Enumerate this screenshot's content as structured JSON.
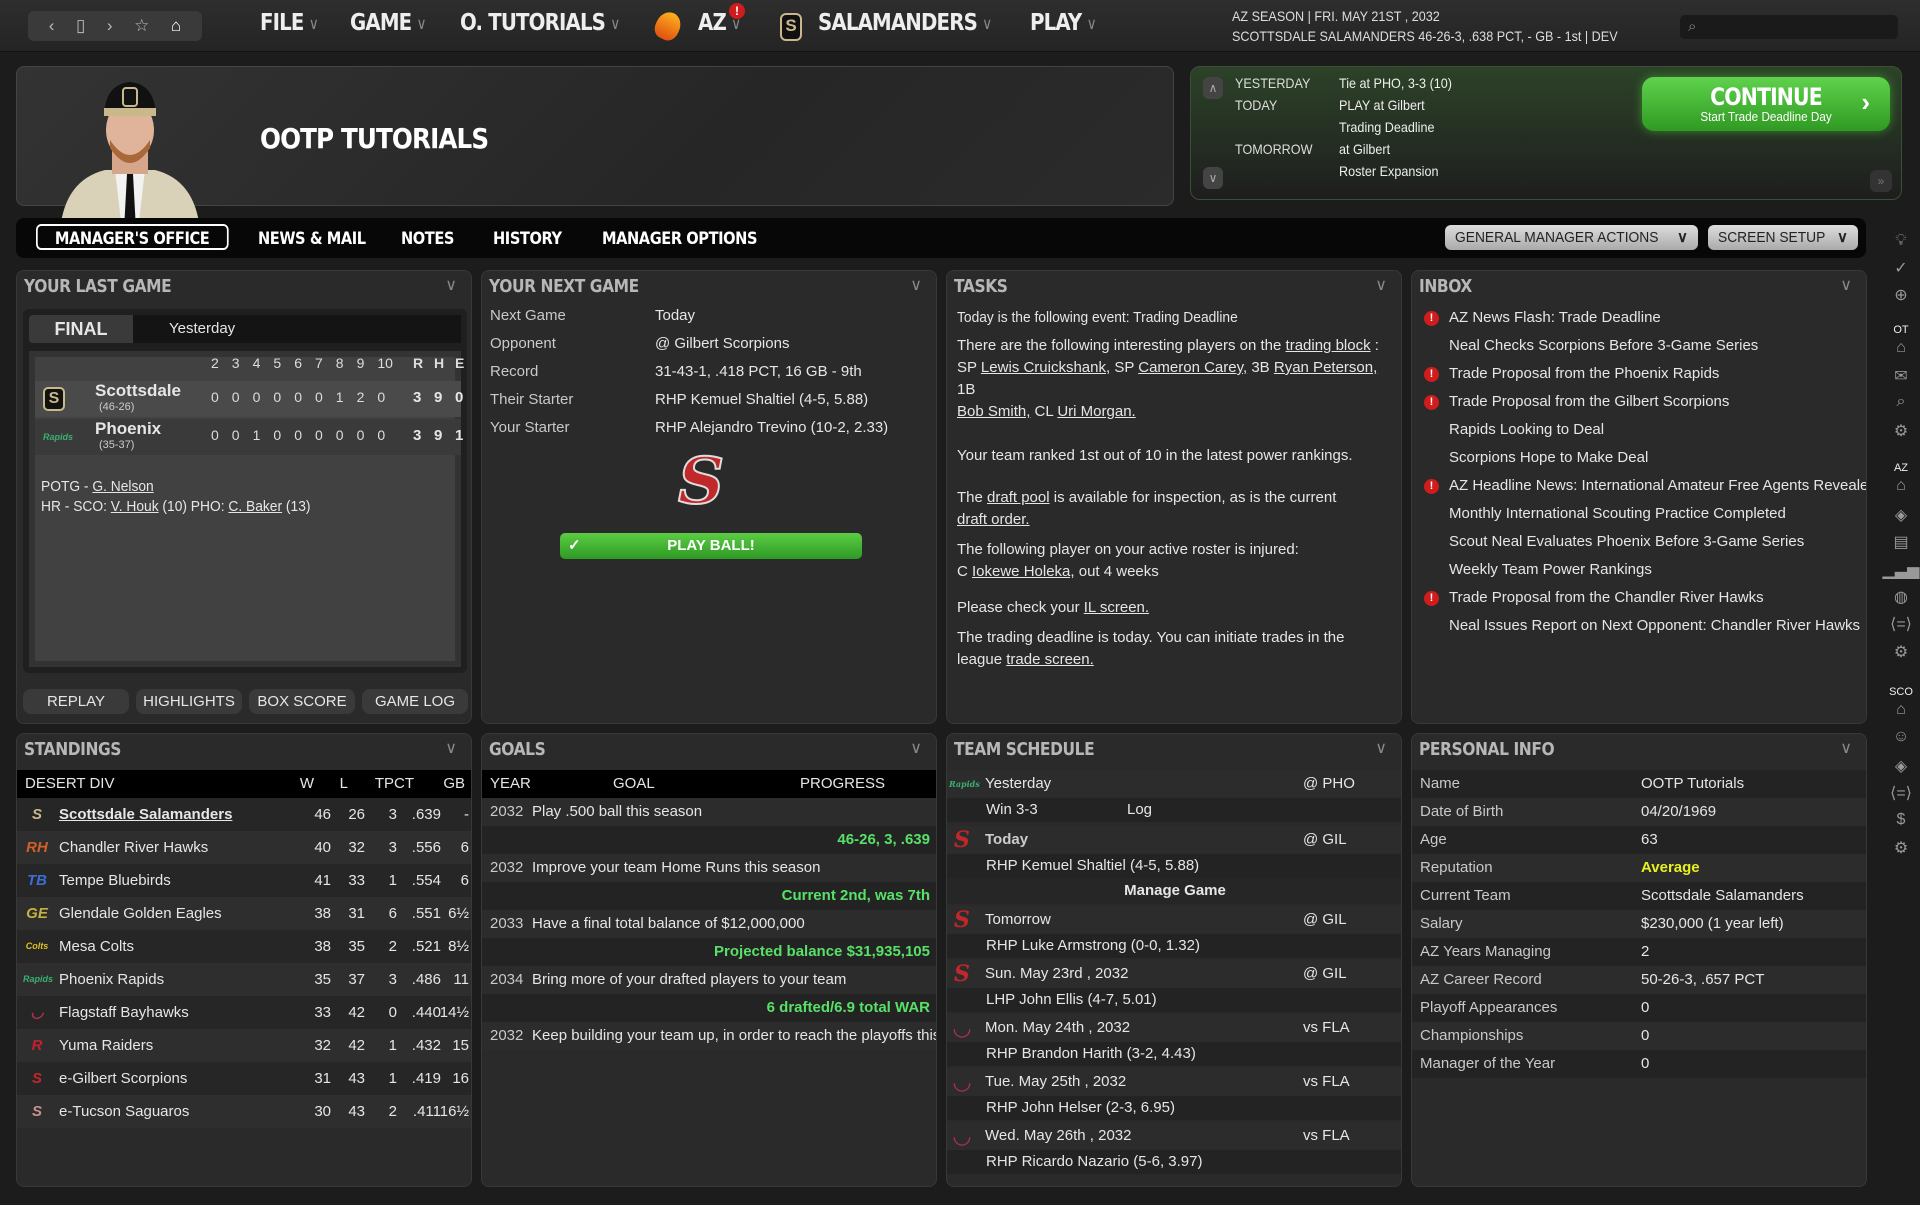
{
  "topbar": {
    "nav_icons": [
      "back-icon",
      "page-icon",
      "forward-icon",
      "star-icon",
      "home-icon"
    ],
    "menus": [
      {
        "label": "FILE"
      },
      {
        "label": "GAME"
      },
      {
        "label": "O. TUTORIALS"
      },
      {
        "label": "AZ",
        "alert": "!"
      },
      {
        "label": "SALAMANDERS"
      },
      {
        "label": "PLAY"
      }
    ],
    "season_line": "AZ SEASON  |  FRI. MAY 21ST , 2032",
    "team_line": "SCOTTSDALE SALAMANDERS   46-26-3, .638 PCT, - GB - 1st | DEV",
    "search_placeholder": ""
  },
  "header": {
    "title": "OOTP TUTORIALS"
  },
  "day_info": {
    "rows": [
      {
        "label": "YESTERDAY",
        "value": "Tie at PHO, 3-3 (10)"
      },
      {
        "label": "TODAY",
        "value": "PLAY at Gilbert"
      },
      {
        "label": "",
        "value": "Trading Deadline"
      },
      {
        "label": "TOMORROW",
        "value": "at Gilbert"
      },
      {
        "label": "",
        "value": "Roster Expansion"
      }
    ],
    "continue_label": "CONTINUE",
    "continue_sub": "Start Trade Deadline Day"
  },
  "tabs": [
    {
      "label": "MANAGER'S OFFICE",
      "active": true
    },
    {
      "label": "NEWS & MAIL"
    },
    {
      "label": "NOTES"
    },
    {
      "label": "HISTORY"
    },
    {
      "label": "MANAGER OPTIONS"
    }
  ],
  "actions": {
    "gm_actions": "GENERAL MANAGER ACTIONS",
    "screen_setup": "SCREEN SETUP"
  },
  "sidebar": {
    "groups": [
      {
        "label": "",
        "icons": [
          "lightbulb-icon",
          "checkmark-icon",
          "globe-icon"
        ]
      },
      {
        "label": "OT",
        "icons": [
          "home-icon",
          "mail-icon",
          "search-icon",
          "gear-icon"
        ]
      },
      {
        "label": "AZ",
        "icons": [
          "home-icon",
          "eye-icon",
          "id-card-icon",
          "bar-chart-icon",
          "baseball-icon",
          "trade-icon",
          "gear-icon"
        ]
      },
      {
        "label": "SCO",
        "icons": [
          "home-icon",
          "manager-icon",
          "eye-icon",
          "trade-icon",
          "dollar-icon",
          "gear-icon"
        ]
      }
    ]
  },
  "last_game": {
    "title": "YOUR LAST GAME",
    "status": "FINAL",
    "when": "Yesterday",
    "innings": [
      "2",
      "3",
      "4",
      "5",
      "6",
      "7",
      "8",
      "9",
      "10"
    ],
    "rhe": [
      "R",
      "H",
      "E"
    ],
    "teams": [
      {
        "name": "Scottsdale",
        "record": "(46-26)",
        "line": [
          "0",
          "0",
          "0",
          "0",
          "0",
          "0",
          "1",
          "2",
          "0"
        ],
        "r": "3",
        "h": "9",
        "e": "0"
      },
      {
        "name": "Phoenix",
        "record": "(35-37)",
        "line": [
          "0",
          "0",
          "1",
          "0",
          "0",
          "0",
          "0",
          "0",
          "0"
        ],
        "r": "3",
        "h": "9",
        "e": "1"
      }
    ],
    "potg_label": "POTG - ",
    "potg": "G. Nelson",
    "hr_label": "HR - SCO: ",
    "hr_sco": "V. Houk",
    "hr_sco_n": " (10)  PHO: ",
    "hr_pho": "C. Baker",
    "hr_pho_n": " (13)",
    "buttons": [
      "REPLAY",
      "HIGHLIGHTS",
      "BOX SCORE",
      "GAME LOG"
    ]
  },
  "next_game": {
    "title": "YOUR NEXT GAME",
    "rows": [
      {
        "label": "Next Game",
        "value": "Today"
      },
      {
        "label": "Opponent",
        "value": "@ Gilbert Scorpions"
      },
      {
        "label": "Record",
        "value": "31-43-1, .418 PCT, 16 GB - 9th"
      },
      {
        "label": "Their Starter",
        "value": "RHP Kemuel Shaltiel (4-5, 5.88)"
      },
      {
        "label": "Your Starter",
        "value": "RHP Alejandro Trevino (10-2, 2.33)"
      }
    ],
    "play_label": "PLAY BALL!"
  },
  "tasks": {
    "title": "TASKS",
    "event": "Today is the following event: Trading Deadline",
    "block_intro": "There are the following interesting players on the ",
    "block_link": "trading block",
    "players": [
      {
        "pos": "SP",
        "name": "Lewis Cruickshank,"
      },
      {
        "pos": "SP",
        "name": "Cameron Carey,"
      },
      {
        "pos": "3B",
        "name": "Ryan Peterson,"
      },
      {
        "pos": "1B",
        "name": "Bob Smith,"
      },
      {
        "pos": "CL",
        "name": "Uri Morgan."
      }
    ],
    "rank": "Your team ranked 1st out of 10 in the latest power rankings.",
    "draft_a": "The ",
    "draft_pool": "draft pool",
    "draft_b": " is available for inspection, as is the current",
    "draft_order": "draft order.",
    "injured": "The following player on your active roster is injured:",
    "inj_pos": "C ",
    "inj_name": "Iokewe Holeka,",
    "inj_out": " out 4 weeks",
    "il_a": "Please check your ",
    "il_link": "IL screen.",
    "trade_a": "The trading deadline is today. You can initiate trades in the",
    "trade_b": "league ",
    "trade_link": "trade screen."
  },
  "inbox": {
    "title": "INBOX",
    "items": [
      {
        "text": "AZ News Flash: Trade Deadline",
        "alert": true
      },
      {
        "text": "Neal Checks Scorpions Before 3-Game Series",
        "alert": false
      },
      {
        "text": "Trade Proposal from the Phoenix Rapids",
        "alert": true
      },
      {
        "text": "Trade Proposal from the Gilbert Scorpions",
        "alert": true
      },
      {
        "text": "Rapids Looking to Deal",
        "alert": false
      },
      {
        "text": "Scorpions Hope to Make Deal",
        "alert": false
      },
      {
        "text": "AZ Headline News: International Amateur Free Agents Reveale",
        "alert": true
      },
      {
        "text": "Monthly International Scouting Practice Completed",
        "alert": false
      },
      {
        "text": "Scout Neal Evaluates Phoenix Before 3-Game Series",
        "alert": false
      },
      {
        "text": "Weekly Team Power Rankings",
        "alert": false
      },
      {
        "text": "Trade Proposal from the Chandler River Hawks",
        "alert": true
      },
      {
        "text": "Neal Issues Report on Next Opponent: Chandler River Hawks",
        "alert": false
      }
    ]
  },
  "standings": {
    "title": "STANDINGS",
    "columns": [
      "DESERT DIV",
      "W",
      "L",
      "T",
      "PCT",
      "GB"
    ],
    "rows": [
      {
        "team": "Scottsdale Salamanders",
        "w": "46",
        "l": "26",
        "t": "3",
        "pct": ".639",
        "gb": "-",
        "own": true,
        "logo": "S",
        "color": "#c9b98a"
      },
      {
        "team": "Chandler River Hawks",
        "w": "40",
        "l": "32",
        "t": "3",
        "pct": ".556",
        "gb": "6",
        "logo": "RH",
        "color": "#d0602a"
      },
      {
        "team": "Tempe Bluebirds",
        "w": "41",
        "l": "33",
        "t": "1",
        "pct": ".554",
        "gb": "6",
        "logo": "TB",
        "color": "#3a6ed0"
      },
      {
        "team": "Glendale Golden Eagles",
        "w": "38",
        "l": "31",
        "t": "6",
        "pct": ".551",
        "gb": "6½",
        "logo": "GE",
        "color": "#c8b040"
      },
      {
        "team": "Mesa Colts",
        "w": "38",
        "l": "35",
        "t": "2",
        "pct": ".521",
        "gb": "8½",
        "logo": "Colts",
        "color": "#e0c020"
      },
      {
        "team": "Phoenix Rapids",
        "w": "35",
        "l": "37",
        "t": "3",
        "pct": ".486",
        "gb": "11",
        "logo": "Rapids",
        "color": "#3ab070"
      },
      {
        "team": "Flagstaff Bayhawks",
        "w": "33",
        "l": "42",
        "t": "0",
        "pct": ".440",
        "gb": "14½",
        "logo": "◡",
        "color": "#b03050"
      },
      {
        "team": "Yuma Raiders",
        "w": "32",
        "l": "42",
        "t": "1",
        "pct": ".432",
        "gb": "15",
        "logo": "R",
        "color": "#c02030"
      },
      {
        "team": "e-Gilbert Scorpions",
        "w": "31",
        "l": "43",
        "t": "1",
        "pct": ".419",
        "gb": "16",
        "logo": "S",
        "color": "#c0282a"
      },
      {
        "team": "e-Tucson Saguaros",
        "w": "30",
        "l": "43",
        "t": "2",
        "pct": ".411",
        "gb": "16½",
        "logo": "S",
        "color": "#c89090"
      }
    ]
  },
  "goals": {
    "title": "GOALS",
    "columns": [
      "YEAR",
      "GOAL",
      "PROGRESS"
    ],
    "rows": [
      {
        "year": "2032",
        "goal": "Play .500 ball this season",
        "progress": "46-26, 3, .639"
      },
      {
        "year": "2032",
        "goal": "Improve your team Home Runs this season",
        "progress": "Current 2nd, was 7th"
      },
      {
        "year": "2033",
        "goal": "Have a final total balance of $12,000,000",
        "progress": "Projected balance $31,935,105"
      },
      {
        "year": "2034",
        "goal": "Bring more of your drafted players to your team",
        "progress": "6 drafted/6.9 total WAR"
      },
      {
        "year": "2032",
        "goal": "Keep building your team up, in order to reach the playoffs  this",
        "progress": ""
      }
    ]
  },
  "schedule": {
    "title": "TEAM SCHEDULE",
    "games": [
      {
        "date": "Yesterday",
        "opp": "@ PHO",
        "detail": "Win 3-3",
        "extra": "Log",
        "logo": "Rapids",
        "color": "#3ab070"
      },
      {
        "date": "Today",
        "opp": "@ GIL",
        "detail": "RHP Kemuel Shaltiel (4-5, 5.88)",
        "manage": "Manage Game",
        "logo": "S",
        "color": "#c0282a"
      },
      {
        "date": "Tomorrow",
        "opp": "@ GIL",
        "detail": "RHP Luke Armstrong (0-0, 1.32)",
        "logo": "S",
        "color": "#c0282a"
      },
      {
        "date": "Sun. May 23rd , 2032",
        "opp": "@ GIL",
        "detail": "LHP John Ellis (4-7, 5.01)",
        "logo": "S",
        "color": "#c0282a"
      },
      {
        "date": "Mon. May 24th , 2032",
        "opp": "vs FLA",
        "detail": "RHP Brandon Harith (3-2, 4.43)",
        "logo": "◡",
        "color": "#b03050"
      },
      {
        "date": "Tue. May 25th , 2032",
        "opp": "vs FLA",
        "detail": "RHP John Helser (2-3, 6.95)",
        "logo": "◡",
        "color": "#b03050"
      },
      {
        "date": "Wed. May 26th , 2032",
        "opp": "vs FLA",
        "detail": "RHP Ricardo Nazario (5-6, 3.97)",
        "logo": "◡",
        "color": "#b03050"
      }
    ]
  },
  "personal": {
    "title": "PERSONAL INFO",
    "rows": [
      {
        "label": "Name",
        "value": "OOTP Tutorials"
      },
      {
        "label": "Date of Birth",
        "value": "04/20/1969"
      },
      {
        "label": "Age",
        "value": "63"
      },
      {
        "label": "Reputation",
        "value": "Average",
        "highlight": "#e8f020"
      },
      {
        "label": "Current Team",
        "value": "Scottsdale Salamanders"
      },
      {
        "label": "Salary",
        "value": "$230,000 (1 year left)"
      },
      {
        "label": "AZ Years Managing",
        "value": "2"
      },
      {
        "label": "AZ Career Record",
        "value": "50-26-3, .657 PCT"
      },
      {
        "label": "Playoff Appearances",
        "value": "0"
      },
      {
        "label": "Championships",
        "value": "0"
      },
      {
        "label": "Manager of the Year",
        "value": "0"
      }
    ]
  },
  "colors": {
    "accent_green": "#58e068",
    "alert_red": "#d01c1c",
    "continue_green": "#45b834",
    "reputation": "#e8f020"
  }
}
